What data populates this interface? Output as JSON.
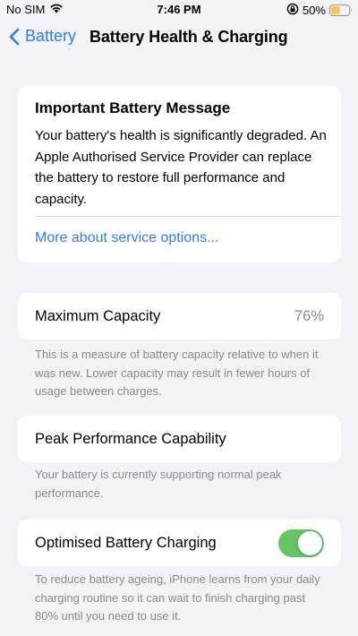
{
  "status_bar": {
    "carrier": "No SIM",
    "time": "7:46 PM",
    "battery_percent": "50%",
    "battery_level": 0.5,
    "icons": [
      "wifi-icon",
      "orientation-lock-icon",
      "battery-icon"
    ]
  },
  "nav": {
    "back_label": "Battery",
    "title": "Battery Health & Charging"
  },
  "message": {
    "title": "Important Battery Message",
    "body": "Your battery's health is significantly degraded. An Apple Authorised Service Provider can replace the battery to restore full performance and capacity.",
    "link": "More about service options..."
  },
  "maximum_capacity": {
    "label": "Maximum Capacity",
    "value": "76%",
    "footnote": "This is a measure of battery capacity relative to when it was new. Lower capacity may result in fewer hours of usage between charges."
  },
  "peak_performance": {
    "label": "Peak Performance Capability",
    "footnote": "Your battery is currently supporting normal peak performance."
  },
  "optimised_charging": {
    "label": "Optimised Battery Charging",
    "enabled": true,
    "footnote": "To reduce battery ageing, iPhone learns from your daily charging routine so it can wait to finish charging past 80% until you need to use it."
  },
  "colors": {
    "accent": "#2f7cf6",
    "toggle_on": "#65c466",
    "background": "#f2f2f7",
    "secondary_text": "#8a8a8e",
    "battery_fill": "#f7c744"
  }
}
